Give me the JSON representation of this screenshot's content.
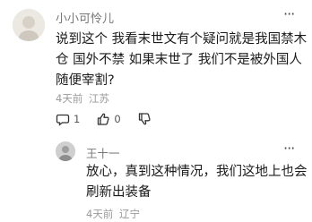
{
  "comment": {
    "author": "小小可怜儿",
    "lines": [
      "说到这个 我看末世文有个疑问就是我国禁木",
      "仓 国外不禁 如果末世了 我们不是被外国人",
      "随便宰割?"
    ],
    "time": "4天前",
    "location": "江苏",
    "reply_count": "1",
    "like_count": "0",
    "more_label": "···"
  },
  "reply": {
    "author": "王十一",
    "lines": [
      "放心，真到这种情况，我们这地上也会",
      "刷新出装备"
    ],
    "time": "4天前",
    "location": "辽宁",
    "more_label": "···"
  }
}
